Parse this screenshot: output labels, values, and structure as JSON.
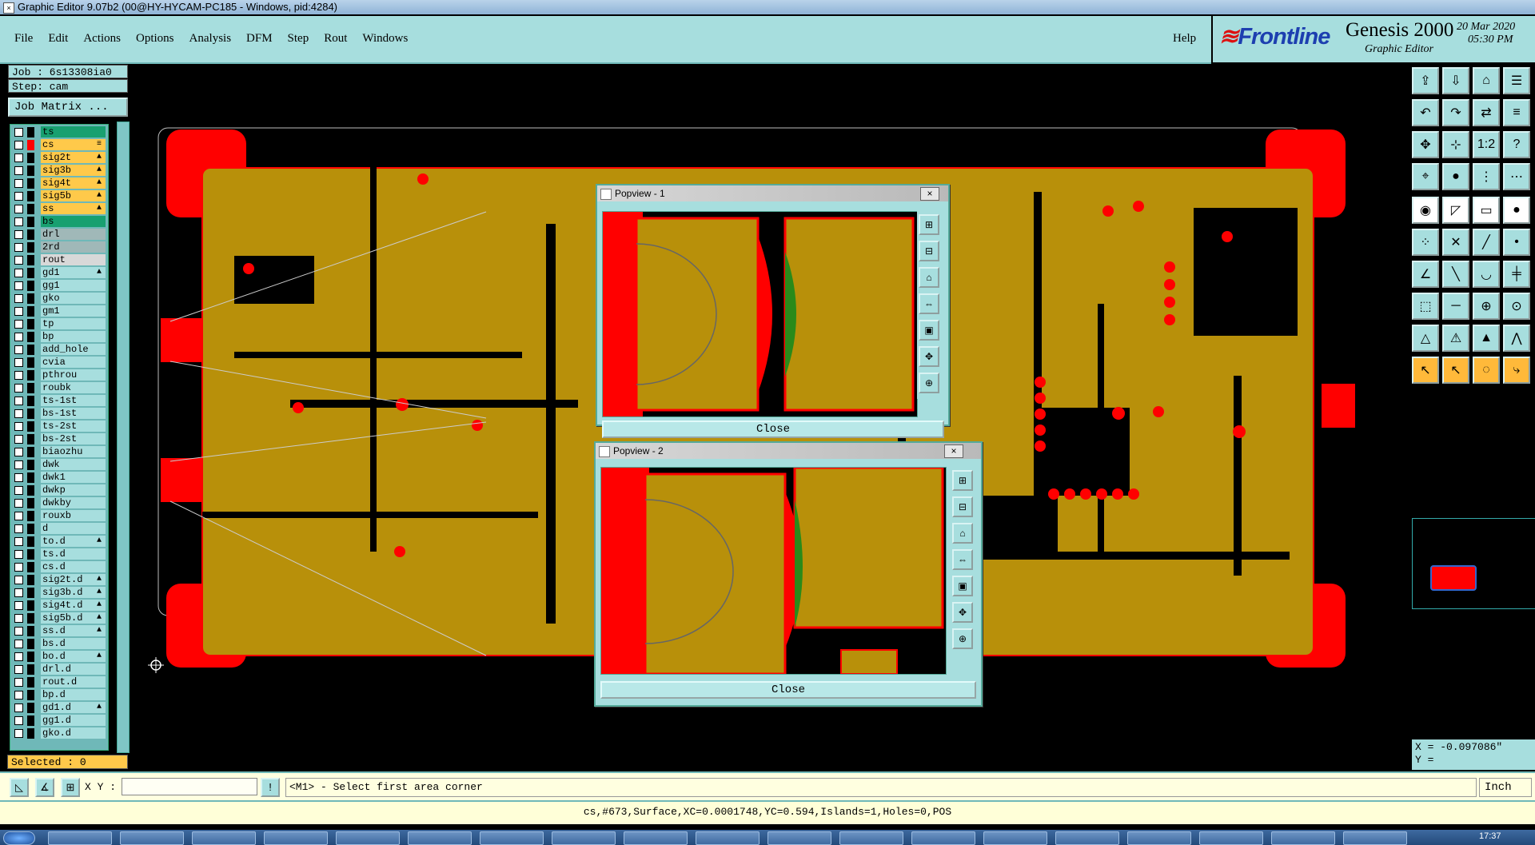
{
  "window": {
    "title": "Graphic Editor 9.07b2 (00@HY-HYCAM-PC185 - Windows, pid:4284)"
  },
  "menu": {
    "items": [
      "File",
      "Edit",
      "Actions",
      "Options",
      "Analysis",
      "DFM",
      "Step",
      "Rout",
      "Windows"
    ],
    "help": "Help"
  },
  "brand": {
    "logo": "Frontline",
    "product": "Genesis 2000",
    "subtitle": "Graphic Editor",
    "date": "20 Mar 2020",
    "time": "05:30 PM"
  },
  "job": {
    "job_line": "Job : 6s13308ia0",
    "step_line": "Step: cam",
    "matrix_button": "Job Matrix ..."
  },
  "layers": [
    {
      "name": "ts",
      "color": "#000",
      "bg": "#18a070",
      "arrow": ""
    },
    {
      "name": "cs",
      "color": "#ff0000",
      "bg": "#ffc94a",
      "arrow": "≡"
    },
    {
      "name": "sig2t",
      "color": "#000",
      "bg": "#ffc94a",
      "arrow": "▲"
    },
    {
      "name": "sig3b",
      "color": "#000",
      "bg": "#ffc94a",
      "arrow": "▲"
    },
    {
      "name": "sig4t",
      "color": "#000",
      "bg": "#ffc94a",
      "arrow": "▲"
    },
    {
      "name": "sig5b",
      "color": "#000",
      "bg": "#ffc94a",
      "arrow": "▲"
    },
    {
      "name": "ss",
      "color": "#000",
      "bg": "#ffc94a",
      "arrow": "▲"
    },
    {
      "name": "bs",
      "color": "#000",
      "bg": "#18a070",
      "arrow": ""
    },
    {
      "name": "drl",
      "color": "#000",
      "bg": "#a0b8b8",
      "arrow": ""
    },
    {
      "name": "2rd",
      "color": "#000",
      "bg": "#a0b8b8",
      "arrow": ""
    },
    {
      "name": "rout",
      "color": "#000",
      "bg": "#d8d8d8",
      "arrow": ""
    },
    {
      "name": "gd1",
      "color": "#000",
      "bg": "#a7dede",
      "arrow": "▲"
    },
    {
      "name": "gg1",
      "color": "#000",
      "bg": "#a7dede",
      "arrow": ""
    },
    {
      "name": "gko",
      "color": "#000",
      "bg": "#a7dede",
      "arrow": ""
    },
    {
      "name": "gm1",
      "color": "#000",
      "bg": "#a7dede",
      "arrow": ""
    },
    {
      "name": "tp",
      "color": "#000",
      "bg": "#a7dede",
      "arrow": ""
    },
    {
      "name": "bp",
      "color": "#000",
      "bg": "#a7dede",
      "arrow": ""
    },
    {
      "name": "add_hole",
      "color": "#000",
      "bg": "#a7dede",
      "arrow": ""
    },
    {
      "name": "cvia",
      "color": "#000",
      "bg": "#a7dede",
      "arrow": ""
    },
    {
      "name": "pthrou",
      "color": "#000",
      "bg": "#a7dede",
      "arrow": ""
    },
    {
      "name": "roubk",
      "color": "#000",
      "bg": "#a7dede",
      "arrow": ""
    },
    {
      "name": "ts-1st",
      "color": "#000",
      "bg": "#a7dede",
      "arrow": ""
    },
    {
      "name": "bs-1st",
      "color": "#000",
      "bg": "#a7dede",
      "arrow": ""
    },
    {
      "name": "ts-2st",
      "color": "#000",
      "bg": "#a7dede",
      "arrow": ""
    },
    {
      "name": "bs-2st",
      "color": "#000",
      "bg": "#a7dede",
      "arrow": ""
    },
    {
      "name": "biaozhu",
      "color": "#000",
      "bg": "#a7dede",
      "arrow": ""
    },
    {
      "name": "dwk",
      "color": "#000",
      "bg": "#a7dede",
      "arrow": ""
    },
    {
      "name": "dwk1",
      "color": "#000",
      "bg": "#a7dede",
      "arrow": ""
    },
    {
      "name": "dwkp",
      "color": "#000",
      "bg": "#a7dede",
      "arrow": ""
    },
    {
      "name": "dwkby",
      "color": "#000",
      "bg": "#a7dede",
      "arrow": ""
    },
    {
      "name": "rouxb",
      "color": "#000",
      "bg": "#a7dede",
      "arrow": ""
    },
    {
      "name": "d",
      "color": "#000",
      "bg": "#a7dede",
      "arrow": ""
    },
    {
      "name": "to.d",
      "color": "#000",
      "bg": "#a7dede",
      "arrow": "▲"
    },
    {
      "name": "ts.d",
      "color": "#000",
      "bg": "#a7dede",
      "arrow": ""
    },
    {
      "name": "cs.d",
      "color": "#000",
      "bg": "#a7dede",
      "arrow": ""
    },
    {
      "name": "sig2t.d",
      "color": "#000",
      "bg": "#a7dede",
      "arrow": "▲"
    },
    {
      "name": "sig3b.d",
      "color": "#000",
      "bg": "#a7dede",
      "arrow": "▲"
    },
    {
      "name": "sig4t.d",
      "color": "#000",
      "bg": "#a7dede",
      "arrow": "▲"
    },
    {
      "name": "sig5b.d",
      "color": "#000",
      "bg": "#a7dede",
      "arrow": "▲"
    },
    {
      "name": "ss.d",
      "color": "#000",
      "bg": "#a7dede",
      "arrow": "▲"
    },
    {
      "name": "bs.d",
      "color": "#000",
      "bg": "#a7dede",
      "arrow": ""
    },
    {
      "name": "bo.d",
      "color": "#000",
      "bg": "#a7dede",
      "arrow": "▲"
    },
    {
      "name": "drl.d",
      "color": "#000",
      "bg": "#a7dede",
      "arrow": ""
    },
    {
      "name": "rout.d",
      "color": "#000",
      "bg": "#a7dede",
      "arrow": ""
    },
    {
      "name": "bp.d",
      "color": "#000",
      "bg": "#a7dede",
      "arrow": ""
    },
    {
      "name": "gd1.d",
      "color": "#000",
      "bg": "#a7dede",
      "arrow": "▲"
    },
    {
      "name": "gg1.d",
      "color": "#000",
      "bg": "#a7dede",
      "arrow": ""
    },
    {
      "name": "gko.d",
      "color": "#000",
      "bg": "#a7dede",
      "arrow": ""
    }
  ],
  "selected": "Selected : 0",
  "popup1": {
    "title": "Popview - 1",
    "close_label": "Close"
  },
  "popup2": {
    "title": "Popview - 2",
    "close_label": "Close"
  },
  "coords": {
    "x": "X = -0.097086\"",
    "y": "Y = "
  },
  "command": {
    "xy_label": "X Y :",
    "xy_value": "",
    "prompt": "<M1> - Select first area corner",
    "units": "Inch"
  },
  "status": "cs,#673,Surface,XC=0.0001748,YC=0.594,Islands=1,Holes=0,POS",
  "clock": "17:37",
  "colors": {
    "copper": "#b8900a",
    "pad": "#ff0000",
    "panel": "#a7dede",
    "highlight": "#ffc94a"
  }
}
